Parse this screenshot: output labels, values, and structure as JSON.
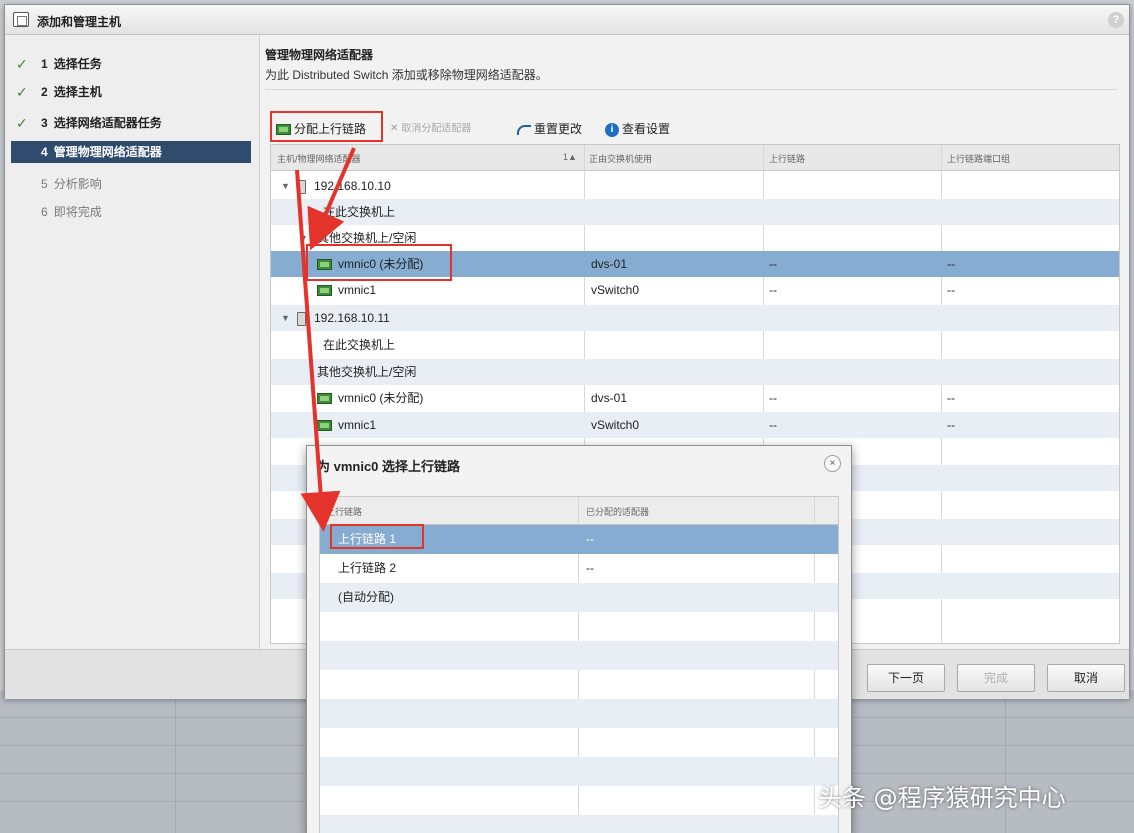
{
  "window": {
    "title": "添加和管理主机",
    "help": "?"
  },
  "steps": [
    {
      "num": "1",
      "label": "选择任务",
      "state": "done"
    },
    {
      "num": "2",
      "label": "选择主机",
      "state": "done"
    },
    {
      "num": "3",
      "label": "选择网络适配器任务",
      "state": "done"
    },
    {
      "num": "4",
      "label": "管理物理网络适配器",
      "state": "active"
    },
    {
      "num": "5",
      "label": "分析影响",
      "state": "future"
    },
    {
      "num": "6",
      "label": "即将完成",
      "state": "future"
    }
  ],
  "section": {
    "title": "管理物理网络适配器",
    "description": "为此 Distributed Switch 添加或移除物理网络适配器。"
  },
  "toolbar": {
    "assign": "分配上行链路",
    "unassign": "取消分配适配器",
    "reset": "重置更改",
    "view": "查看设置"
  },
  "grid": {
    "headers": [
      "主机/物理网络适配器",
      "1▲",
      "正由交换机使用",
      "上行链路",
      "上行链路端口组"
    ],
    "rows": [
      {
        "name": "192.168.10.10",
        "switch": "",
        "uplink": "",
        "portgroup": ""
      },
      {
        "name": "在此交换机上",
        "switch": "",
        "uplink": "",
        "portgroup": ""
      },
      {
        "name": "其他交换机上/空闲",
        "switch": "",
        "uplink": "",
        "portgroup": ""
      },
      {
        "name": "vmnic0 (未分配)",
        "switch": "dvs-01",
        "uplink": "--",
        "portgroup": "--"
      },
      {
        "name": "vmnic1",
        "switch": "vSwitch0",
        "uplink": "--",
        "portgroup": "--"
      },
      {
        "name": "192.168.10.11",
        "switch": "",
        "uplink": "",
        "portgroup": ""
      },
      {
        "name": "在此交换机上",
        "switch": "",
        "uplink": "",
        "portgroup": ""
      },
      {
        "name": "其他交换机上/空闲",
        "switch": "",
        "uplink": "",
        "portgroup": ""
      },
      {
        "name": "vmnic0 (未分配)",
        "switch": "dvs-01",
        "uplink": "--",
        "portgroup": "--"
      },
      {
        "name": "vmnic1",
        "switch": "vSwitch0",
        "uplink": "--",
        "portgroup": "--"
      }
    ]
  },
  "footer": {
    "next": "下一页",
    "finish": "完成",
    "cancel": "取消"
  },
  "dialog": {
    "title": "为 vmnic0 选择上行链路",
    "close": "×",
    "headers": [
      "上行链路",
      "已分配的适配器"
    ],
    "rows": [
      {
        "uplink": "上行链路 1",
        "adapter": "--"
      },
      {
        "uplink": "上行链路 2",
        "adapter": "--"
      },
      {
        "uplink": "(自动分配)",
        "adapter": ""
      }
    ]
  },
  "watermark": "头条 @程序猿研究中心",
  "colors": {
    "accent": "#2f4b6e",
    "selection": "#86acd1",
    "annotation": "#e3332b"
  }
}
